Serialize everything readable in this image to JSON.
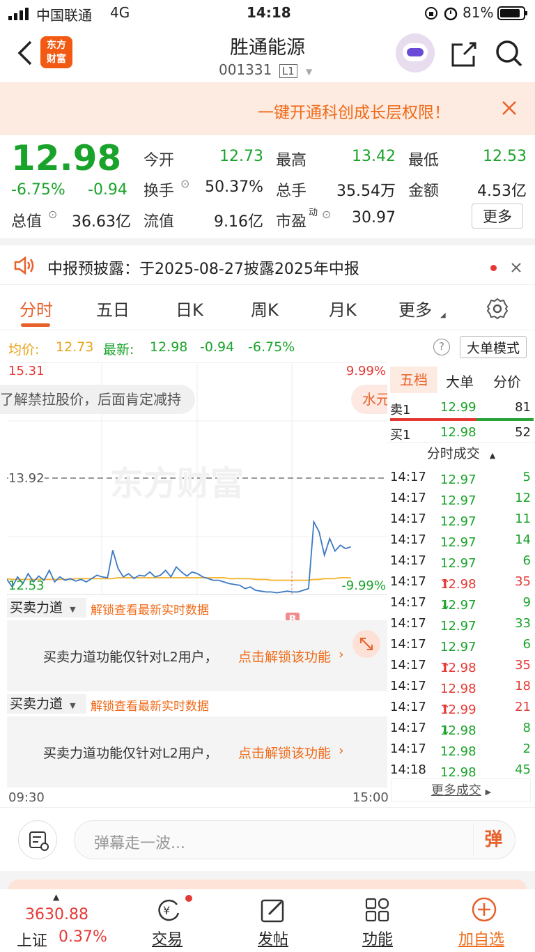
{
  "status_bar": {
    "carrier": "中国联通",
    "network": "4G",
    "time": "14:18",
    "battery": "81%"
  },
  "header": {
    "title": "胜通能源",
    "code": "001331",
    "level": "L1",
    "logo_text": "东方财富"
  },
  "banner": {
    "text": "一键开通科创成长层权限！"
  },
  "quote": {
    "price": "12.98",
    "change_pct": "-6.75%",
    "change": "-0.94",
    "open_label": "今开",
    "open": "12.73",
    "high_label": "最高",
    "high": "13.42",
    "low_label": "最低",
    "low": "12.53",
    "turnover_label": "换手",
    "turnover": "50.37%",
    "volume_label": "总手",
    "volume": "35.54万",
    "amount_label": "金额",
    "amount": "4.53亿",
    "mcap_label": "总值",
    "mcap": "36.63亿",
    "float_label": "流值",
    "float": "9.16亿",
    "pe_label": "市盈",
    "pe_sup": "动",
    "pe": "30.97",
    "more_label": "更多"
  },
  "notice": {
    "text": "中报预披露：于2025-08-27披露2025年中报"
  },
  "tabs": [
    "分时",
    "五日",
    "日K",
    "周K",
    "月K",
    "更多"
  ],
  "avg_line": {
    "avg_label": "均价:",
    "avg": "12.73",
    "latest_label": "最新:",
    "latest": "12.98",
    "change": "-0.94",
    "pct": "-6.75%",
    "mode_btn": "大单模式"
  },
  "chart_data": {
    "type": "line",
    "top_price": "15.31",
    "top_pct": "9.99%",
    "bottom_price": "12.53",
    "bottom_pct": "-9.99%",
    "ref_price": "13.92",
    "x_start": "09:30",
    "x_end": "15:00",
    "ylim": [
      12.53,
      15.31
    ],
    "watermark": "东方财富",
    "marker": "B",
    "danmu": "了解禁拉股价，后面肯定减持",
    "danmu2": "水元",
    "price_series": [
      12.71,
      12.62,
      12.74,
      12.66,
      12.78,
      12.68,
      12.75,
      12.7,
      12.82,
      12.68,
      12.74,
      12.7,
      12.72,
      12.69,
      12.71,
      12.68,
      12.72,
      12.76,
      12.74,
      12.73,
      13.06,
      12.84,
      12.74,
      12.78,
      12.72,
      12.76,
      12.75,
      12.8,
      12.74,
      12.76,
      12.82,
      12.74,
      12.86,
      12.8,
      12.75,
      12.8,
      12.78,
      12.74,
      12.72,
      12.7,
      12.7,
      12.68,
      12.66,
      12.65,
      12.64,
      12.6,
      12.62,
      12.58,
      12.57,
      12.56,
      12.56,
      12.55,
      12.56,
      12.57,
      12.56,
      12.56,
      12.58,
      12.6,
      13.4,
      13.28,
      13.0,
      13.2,
      13.05,
      13.12,
      13.08,
      13.1
    ],
    "avg_series": [
      12.72,
      12.71,
      12.71,
      12.71,
      12.71,
      12.71,
      12.71,
      12.71,
      12.71,
      12.71,
      12.71,
      12.71,
      12.71,
      12.72,
      12.72,
      12.72,
      12.72,
      12.72,
      12.72,
      12.72,
      12.72,
      12.73,
      12.73,
      12.73,
      12.73,
      12.73,
      12.73,
      12.73,
      12.73,
      12.73,
      12.73,
      12.73,
      12.73,
      12.73,
      12.73,
      12.73,
      12.73,
      12.73,
      12.73,
      12.73,
      12.73,
      12.73,
      12.72,
      12.72,
      12.72,
      12.72,
      12.72,
      12.71,
      12.71,
      12.71,
      12.7,
      12.7,
      12.7,
      12.7,
      12.7,
      12.7,
      12.7,
      12.7,
      12.71,
      12.71,
      12.72,
      12.72,
      12.72,
      12.73,
      12.73,
      12.73
    ]
  },
  "power": {
    "label": "买卖力道",
    "unlock": "解锁查看最新实时数据",
    "lock_msg": "买卖力道功能仅针对L2用户，",
    "lock_link": "点击解锁该功能"
  },
  "book": {
    "tabs": [
      "五档",
      "大单",
      "分价"
    ],
    "sell": {
      "label": "卖1",
      "price": "12.99",
      "vol": "81"
    },
    "buy": {
      "label": "买1",
      "price": "12.98",
      "vol": "52"
    },
    "trades_title": "分时成交",
    "trades": [
      {
        "t": "14:17",
        "p": "12.97",
        "d": "",
        "v": "5",
        "c": "green"
      },
      {
        "t": "14:17",
        "p": "12.97",
        "d": "",
        "v": "12",
        "c": "green"
      },
      {
        "t": "14:17",
        "p": "12.97",
        "d": "",
        "v": "11",
        "c": "green"
      },
      {
        "t": "14:17",
        "p": "12.97",
        "d": "",
        "v": "14",
        "c": "green"
      },
      {
        "t": "14:17",
        "p": "12.97",
        "d": "",
        "v": "6",
        "c": "green"
      },
      {
        "t": "14:17",
        "p": "12.98",
        "d": "↑",
        "v": "35",
        "c": "red"
      },
      {
        "t": "14:17",
        "p": "12.97",
        "d": "↓",
        "v": "9",
        "c": "green"
      },
      {
        "t": "14:17",
        "p": "12.97",
        "d": "",
        "v": "33",
        "c": "green"
      },
      {
        "t": "14:17",
        "p": "12.97",
        "d": "",
        "v": "6",
        "c": "green"
      },
      {
        "t": "14:17",
        "p": "12.98",
        "d": "↑",
        "v": "35",
        "c": "red"
      },
      {
        "t": "14:17",
        "p": "12.98",
        "d": "",
        "v": "18",
        "c": "red"
      },
      {
        "t": "14:17",
        "p": "12.99",
        "d": "↑",
        "v": "21",
        "c": "red"
      },
      {
        "t": "14:17",
        "p": "12.98",
        "d": "↓",
        "v": "8",
        "c": "green"
      },
      {
        "t": "14:17",
        "p": "12.98",
        "d": "",
        "v": "2",
        "c": "green"
      },
      {
        "t": "14:18",
        "p": "12.98",
        "d": "",
        "v": "45",
        "c": "green"
      }
    ],
    "more_trades": "更多成交"
  },
  "comment": {
    "placeholder": "弹幕走一波...",
    "btn": "弹"
  },
  "tabbar": {
    "index_value": "3630.88",
    "index_name": "上证",
    "index_pct": "0.37%",
    "items": [
      "交易",
      "发帖",
      "功能",
      "加自选"
    ]
  }
}
